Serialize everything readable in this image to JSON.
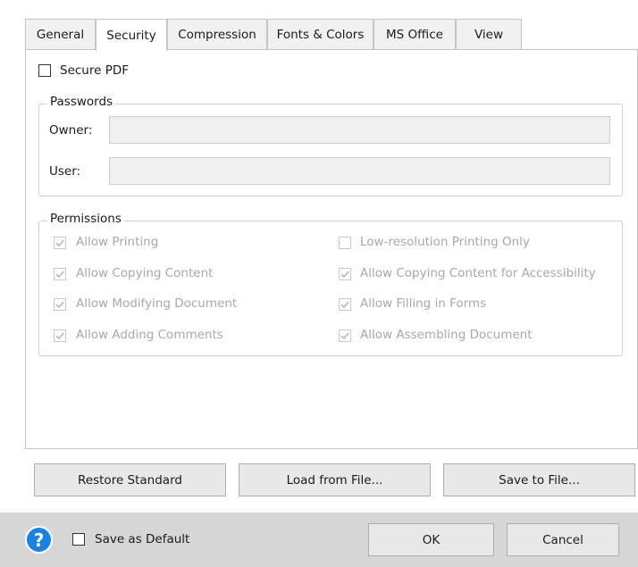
{
  "tabs": [
    {
      "label": "General"
    },
    {
      "label": "Security",
      "active": true
    },
    {
      "label": "Compression"
    },
    {
      "label": "Fonts & Colors"
    },
    {
      "label": "MS Office"
    },
    {
      "label": "View"
    }
  ],
  "security": {
    "secure_pdf": {
      "label": "Secure PDF",
      "checked": false
    },
    "passwords": {
      "legend": "Passwords",
      "owner_label": "Owner:",
      "owner_value": "",
      "user_label": "User:",
      "user_value": ""
    },
    "permissions": {
      "legend": "Permissions",
      "items": [
        {
          "label": "Allow Printing",
          "checked": true,
          "enabled": false
        },
        {
          "label": "Low-resolution Printing Only",
          "checked": false,
          "enabled": false
        },
        {
          "label": "Allow Copying Content",
          "checked": true,
          "enabled": false
        },
        {
          "label": "Allow Copying Content for Accessibility",
          "checked": true,
          "enabled": false
        },
        {
          "label": "Allow Modifying Document",
          "checked": true,
          "enabled": false
        },
        {
          "label": "Allow Filling in Forms",
          "checked": true,
          "enabled": false
        },
        {
          "label": "Allow Adding Comments",
          "checked": true,
          "enabled": false
        },
        {
          "label": "Allow Assembling Document",
          "checked": true,
          "enabled": false
        }
      ]
    }
  },
  "actions": {
    "restore": "Restore Standard",
    "load": "Load from File...",
    "save": "Save to File..."
  },
  "footer": {
    "help_icon": "?",
    "save_default": {
      "label": "Save as Default",
      "checked": false
    },
    "ok": "OK",
    "cancel": "Cancel"
  },
  "colors": {
    "accent": "#1a82e0",
    "footer_bg": "#d6d6d6",
    "disabled_text": "#a8a8a8"
  }
}
